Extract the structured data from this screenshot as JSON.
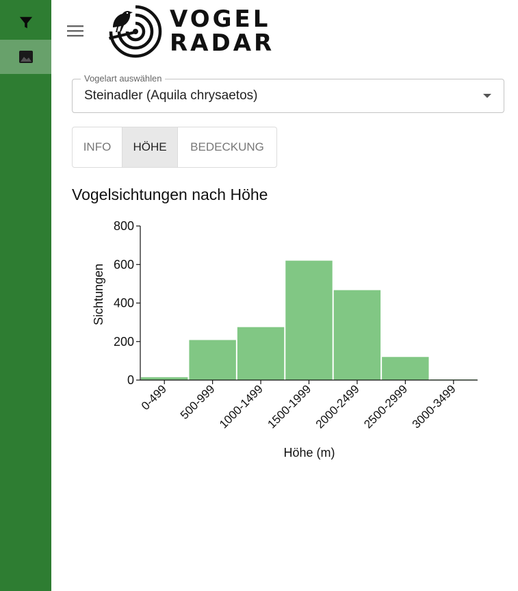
{
  "sidebar": {
    "items": [
      {
        "icon": "filter-icon",
        "active": false
      },
      {
        "icon": "image-icon",
        "active": true
      }
    ],
    "color": "#2e7d32"
  },
  "header": {
    "logo_line1": "VOGEL",
    "logo_line2": "RADAR"
  },
  "species_select": {
    "label": "Vogelart auswählen",
    "value": "Steinadler (Aquila chrysaetos)"
  },
  "tabs": [
    {
      "label": "INFO",
      "active": false
    },
    {
      "label": "HÖHE",
      "active": true
    },
    {
      "label": "BEDECKUNG",
      "active": false
    }
  ],
  "chart_title": "Vogelsichtungen nach Höhe",
  "chart_data": {
    "type": "bar",
    "categories": [
      "0-499",
      "500-999",
      "1000-1499",
      "1500-1999",
      "2000-2499",
      "2500-2999",
      "3000-3499"
    ],
    "values": [
      15,
      208,
      275,
      620,
      467,
      120,
      3
    ],
    "xlabel": "Höhe (m)",
    "ylabel": "Sichtungen",
    "ylim": [
      0,
      800
    ],
    "yticks": [
      0,
      200,
      400,
      600,
      800
    ],
    "color": "#81c784",
    "grid": false
  }
}
